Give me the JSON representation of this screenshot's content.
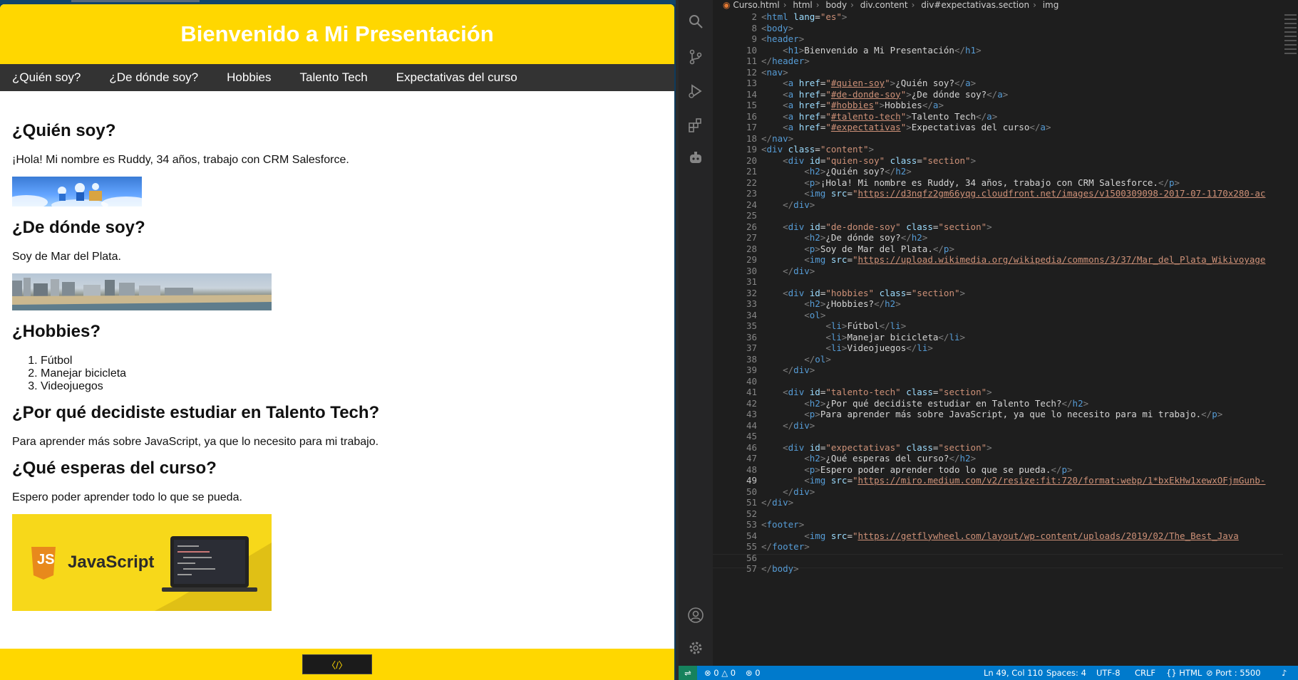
{
  "site": {
    "header_title": "Bienvenido a Mi Presentación",
    "nav": [
      "¿Quién soy?",
      "¿De dónde soy?",
      "Hobbies",
      "Talento Tech",
      "Expectativas del curso"
    ],
    "quien_title": "¿Quién soy?",
    "quien_text": "¡Hola! Mi nombre es Ruddy, 34 años, trabajo con CRM Salesforce.",
    "donde_title": "¿De dónde soy?",
    "donde_text": "Soy de Mar del Plata.",
    "hobbies_title": "¿Hobbies?",
    "hobbies": [
      "Fútbol",
      "Manejar bicicleta",
      "Videojuegos"
    ],
    "talento_title": "¿Por qué decidiste estudiar en Talento Tech?",
    "talento_text": "Para aprender más sobre JavaScript, ya que lo necesito para mi trabajo.",
    "expect_title": "¿Qué esperas del curso?",
    "expect_text": "Espero poder aprender todo lo que se pueda.",
    "js_image_label": "JavaScript",
    "js_badge": "JS",
    "footer_icon": "〈/〉"
  },
  "breadcrumb": [
    "Curso.html",
    "html",
    "body",
    "div.content",
    "div#expectativas.section",
    "img"
  ],
  "code_lines": [
    {
      "n": 2,
      "html": "<span class='br'>&lt;</span><span class='t'>html</span> <span class='a'>lang</span>=<span class='s'>\"es\"</span><span class='br'>&gt;</span>"
    },
    {
      "n": 8,
      "html": "<span class='br'>&lt;</span><span class='t'>body</span><span class='br'>&gt;</span>"
    },
    {
      "n": 9,
      "html": "<span class='br'>&lt;</span><span class='t'>header</span><span class='br'>&gt;</span>"
    },
    {
      "n": 10,
      "html": "    <span class='br'>&lt;</span><span class='t'>h1</span><span class='br'>&gt;</span>Bienvenido a Mi Presentación<span class='br'>&lt;/</span><span class='t'>h1</span><span class='br'>&gt;</span>"
    },
    {
      "n": 11,
      "html": "<span class='br'>&lt;/</span><span class='t'>header</span><span class='br'>&gt;</span>"
    },
    {
      "n": 12,
      "html": "<span class='br'>&lt;</span><span class='t'>nav</span><span class='br'>&gt;</span>"
    },
    {
      "n": 13,
      "html": "    <span class='br'>&lt;</span><span class='t'>a</span> <span class='a'>href</span>=<span class='s'>\"</span><span class='u'>#quien-soy</span><span class='s'>\"</span><span class='br'>&gt;</span>¿Quién soy?<span class='br'>&lt;/</span><span class='t'>a</span><span class='br'>&gt;</span>"
    },
    {
      "n": 14,
      "html": "    <span class='br'>&lt;</span><span class='t'>a</span> <span class='a'>href</span>=<span class='s'>\"</span><span class='u'>#de-donde-soy</span><span class='s'>\"</span><span class='br'>&gt;</span>¿De dónde soy?<span class='br'>&lt;/</span><span class='t'>a</span><span class='br'>&gt;</span>"
    },
    {
      "n": 15,
      "html": "    <span class='br'>&lt;</span><span class='t'>a</span> <span class='a'>href</span>=<span class='s'>\"</span><span class='u'>#hobbies</span><span class='s'>\"</span><span class='br'>&gt;</span>Hobbies<span class='br'>&lt;/</span><span class='t'>a</span><span class='br'>&gt;</span>"
    },
    {
      "n": 16,
      "html": "    <span class='br'>&lt;</span><span class='t'>a</span> <span class='a'>href</span>=<span class='s'>\"</span><span class='u'>#talento-tech</span><span class='s'>\"</span><span class='br'>&gt;</span>Talento Tech<span class='br'>&lt;/</span><span class='t'>a</span><span class='br'>&gt;</span>"
    },
    {
      "n": 17,
      "html": "    <span class='br'>&lt;</span><span class='t'>a</span> <span class='a'>href</span>=<span class='s'>\"</span><span class='u'>#expectativas</span><span class='s'>\"</span><span class='br'>&gt;</span>Expectativas del curso<span class='br'>&lt;/</span><span class='t'>a</span><span class='br'>&gt;</span>"
    },
    {
      "n": 18,
      "html": "<span class='br'>&lt;/</span><span class='t'>nav</span><span class='br'>&gt;</span>"
    },
    {
      "n": 19,
      "html": "<span class='br'>&lt;</span><span class='t'>div</span> <span class='a'>class</span>=<span class='s'>\"content\"</span><span class='br'>&gt;</span>"
    },
    {
      "n": 20,
      "html": "    <span class='br'>&lt;</span><span class='t'>div</span> <span class='a'>id</span>=<span class='s'>\"quien-soy\"</span> <span class='a'>class</span>=<span class='s'>\"section\"</span><span class='br'>&gt;</span>"
    },
    {
      "n": 21,
      "html": "        <span class='br'>&lt;</span><span class='t'>h2</span><span class='br'>&gt;</span>¿Quién soy?<span class='br'>&lt;/</span><span class='t'>h2</span><span class='br'>&gt;</span>"
    },
    {
      "n": 22,
      "html": "        <span class='br'>&lt;</span><span class='t'>p</span><span class='br'>&gt;</span>¡Hola! Mi nombre es Ruddy, 34 años, trabajo con CRM Salesforce.<span class='br'>&lt;/</span><span class='t'>p</span><span class='br'>&gt;</span>"
    },
    {
      "n": 23,
      "html": "        <span class='br'>&lt;</span><span class='t'>img</span> <span class='a'>src</span>=<span class='s'>\"</span><span class='u'>https://d3nqfz2gm66yqg.cloudfront.net/images/v1500309098-2017-07-1170x280-ac</span>"
    },
    {
      "n": 24,
      "html": "    <span class='br'>&lt;/</span><span class='t'>div</span><span class='br'>&gt;</span>"
    },
    {
      "n": 25,
      "html": ""
    },
    {
      "n": 26,
      "html": "    <span class='br'>&lt;</span><span class='t'>div</span> <span class='a'>id</span>=<span class='s'>\"de-donde-soy\"</span> <span class='a'>class</span>=<span class='s'>\"section\"</span><span class='br'>&gt;</span>"
    },
    {
      "n": 27,
      "html": "        <span class='br'>&lt;</span><span class='t'>h2</span><span class='br'>&gt;</span>¿De dónde soy?<span class='br'>&lt;/</span><span class='t'>h2</span><span class='br'>&gt;</span>"
    },
    {
      "n": 28,
      "html": "        <span class='br'>&lt;</span><span class='t'>p</span><span class='br'>&gt;</span>Soy de Mar del Plata.<span class='br'>&lt;/</span><span class='t'>p</span><span class='br'>&gt;</span>"
    },
    {
      "n": 29,
      "html": "        <span class='br'>&lt;</span><span class='t'>img</span> <span class='a'>src</span>=<span class='s'>\"</span><span class='u'>https://upload.wikimedia.org/wikipedia/commons/3/37/Mar_del_Plata_Wikivoyage</span>"
    },
    {
      "n": 30,
      "html": "    <span class='br'>&lt;/</span><span class='t'>div</span><span class='br'>&gt;</span>"
    },
    {
      "n": 31,
      "html": ""
    },
    {
      "n": 32,
      "html": "    <span class='br'>&lt;</span><span class='t'>div</span> <span class='a'>id</span>=<span class='s'>\"hobbies\"</span> <span class='a'>class</span>=<span class='s'>\"section\"</span><span class='br'>&gt;</span>"
    },
    {
      "n": 33,
      "html": "        <span class='br'>&lt;</span><span class='t'>h2</span><span class='br'>&gt;</span>¿Hobbies?<span class='br'>&lt;/</span><span class='t'>h2</span><span class='br'>&gt;</span>"
    },
    {
      "n": 34,
      "html": "        <span class='br'>&lt;</span><span class='t'>ol</span><span class='br'>&gt;</span>"
    },
    {
      "n": 35,
      "html": "            <span class='br'>&lt;</span><span class='t'>li</span><span class='br'>&gt;</span>Fútbol<span class='br'>&lt;/</span><span class='t'>li</span><span class='br'>&gt;</span>"
    },
    {
      "n": 36,
      "html": "            <span class='br'>&lt;</span><span class='t'>li</span><span class='br'>&gt;</span>Manejar bicicleta<span class='br'>&lt;/</span><span class='t'>li</span><span class='br'>&gt;</span>"
    },
    {
      "n": 37,
      "html": "            <span class='br'>&lt;</span><span class='t'>li</span><span class='br'>&gt;</span>Videojuegos<span class='br'>&lt;/</span><span class='t'>li</span><span class='br'>&gt;</span>"
    },
    {
      "n": 38,
      "html": "        <span class='br'>&lt;/</span><span class='t'>ol</span><span class='br'>&gt;</span>"
    },
    {
      "n": 39,
      "html": "    <span class='br'>&lt;/</span><span class='t'>div</span><span class='br'>&gt;</span>"
    },
    {
      "n": 40,
      "html": ""
    },
    {
      "n": 41,
      "html": "    <span class='br'>&lt;</span><span class='t'>div</span> <span class='a'>id</span>=<span class='s'>\"talento-tech\"</span> <span class='a'>class</span>=<span class='s'>\"section\"</span><span class='br'>&gt;</span>"
    },
    {
      "n": 42,
      "html": "        <span class='br'>&lt;</span><span class='t'>h2</span><span class='br'>&gt;</span>¿Por qué decidiste estudiar en Talento Tech?<span class='br'>&lt;/</span><span class='t'>h2</span><span class='br'>&gt;</span>"
    },
    {
      "n": 43,
      "html": "        <span class='br'>&lt;</span><span class='t'>p</span><span class='br'>&gt;</span>Para aprender más sobre JavaScript, ya que lo necesito para mi trabajo.<span class='br'>&lt;/</span><span class='t'>p</span><span class='br'>&gt;</span>"
    },
    {
      "n": 44,
      "html": "    <span class='br'>&lt;/</span><span class='t'>div</span><span class='br'>&gt;</span>"
    },
    {
      "n": 45,
      "html": ""
    },
    {
      "n": 46,
      "html": "    <span class='br'>&lt;</span><span class='t'>div</span> <span class='a'>id</span>=<span class='s'>\"expectativas\"</span> <span class='a'>class</span>=<span class='s'>\"section\"</span><span class='br'>&gt;</span>"
    },
    {
      "n": 47,
      "html": "        <span class='br'>&lt;</span><span class='t'>h2</span><span class='br'>&gt;</span>¿Qué esperas del curso?<span class='br'>&lt;/</span><span class='t'>h2</span><span class='br'>&gt;</span>"
    },
    {
      "n": 48,
      "html": "        <span class='br'>&lt;</span><span class='t'>p</span><span class='br'>&gt;</span>Espero poder aprender todo lo que se pueda.<span class='br'>&lt;/</span><span class='t'>p</span><span class='br'>&gt;</span>"
    },
    {
      "n": 49,
      "html": "        <span class='br'>&lt;</span><span class='t'>img</span> <span class='a'>src</span>=<span class='s'>\"</span><span class='u'>https://miro.medium.com/v2/resize:fit:720/format:webp/1*bxEkHw1xewxOFjmGunb-</span>",
      "current": true
    },
    {
      "n": 50,
      "html": "    <span class='br'>&lt;/</span><span class='t'>div</span><span class='br'>&gt;</span>"
    },
    {
      "n": 51,
      "html": "<span class='br'>&lt;/</span><span class='t'>div</span><span class='br'>&gt;</span>"
    },
    {
      "n": 52,
      "html": ""
    },
    {
      "n": 53,
      "html": "<span class='br'>&lt;</span><span class='t'>footer</span><span class='br'>&gt;</span>"
    },
    {
      "n": 54,
      "html": "        <span class='br'>&lt;</span><span class='t'>img</span> <span class='a'>src</span>=<span class='s'>\"</span><span class='u'>https://getflywheel.com/layout/wp-content/uploads/2019/02/The_Best_Java</span>"
    },
    {
      "n": 55,
      "html": "<span class='br'>&lt;/</span><span class='t'>footer</span><span class='br'>&gt;</span>"
    },
    {
      "n": 56,
      "html": ""
    },
    {
      "n": 57,
      "html": "<span class='br'>&lt;/</span><span class='t'>body</span><span class='br'>&gt;</span>"
    }
  ],
  "status": {
    "errors": "0",
    "warnings": "0",
    "ports": "0",
    "position": "Ln 49, Col 110",
    "spaces": "Spaces: 4",
    "encoding": "UTF-8",
    "eol": "CRLF",
    "language": "HTML",
    "port": "Port : 5500"
  },
  "colors": {
    "header": "#ffd700",
    "nav": "#333333",
    "statusbar": "#007acc"
  },
  "icons": [
    "search-icon",
    "source-control-icon",
    "run-debug-icon",
    "extensions-icon",
    "remote-explorer-icon",
    "account-icon",
    "settings-gear-icon"
  ]
}
